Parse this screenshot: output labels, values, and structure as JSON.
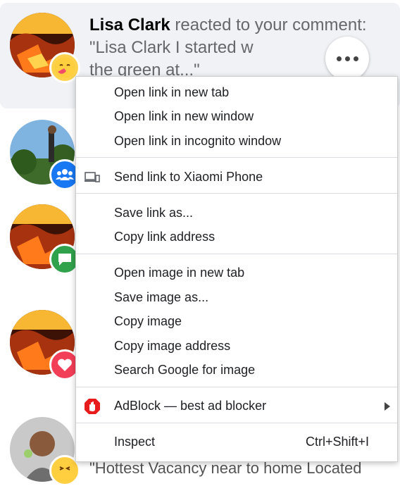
{
  "notification": {
    "actor": "Lisa Clark",
    "text": " reacted to your comment: \"Lisa Clark I started w",
    "text_line2": "the green at...\""
  },
  "bottom_snippet": "\"Hottest Vacancy near to home Located",
  "context_menu": {
    "group1": [
      "Open link in new tab",
      "Open link in new window",
      "Open link in incognito window"
    ],
    "send_to_device": "Send link to Xiaomi Phone",
    "group3": [
      "Save link as...",
      "Copy link address"
    ],
    "group4": [
      "Open image in new tab",
      "Save image as...",
      "Copy image",
      "Copy image address",
      "Search Google for image"
    ],
    "adblock": "AdBlock — best ad blocker",
    "inspect": "Inspect",
    "inspect_shortcut": "Ctrl+Shift+I"
  },
  "colors": {
    "highlight_bg": "#f0f2f5",
    "group_badge": "#1877f2",
    "comment_badge": "#31a24c",
    "heart_badge": "#f33e58",
    "adblock_red": "#e81c1c"
  },
  "icons": [
    "reaction-emoji-icon",
    "more-options-icon",
    "group-icon",
    "comment-icon",
    "heart-icon",
    "device-icon",
    "adblock-icon",
    "submenu-arrow-icon",
    "laughing-emoji-icon"
  ]
}
